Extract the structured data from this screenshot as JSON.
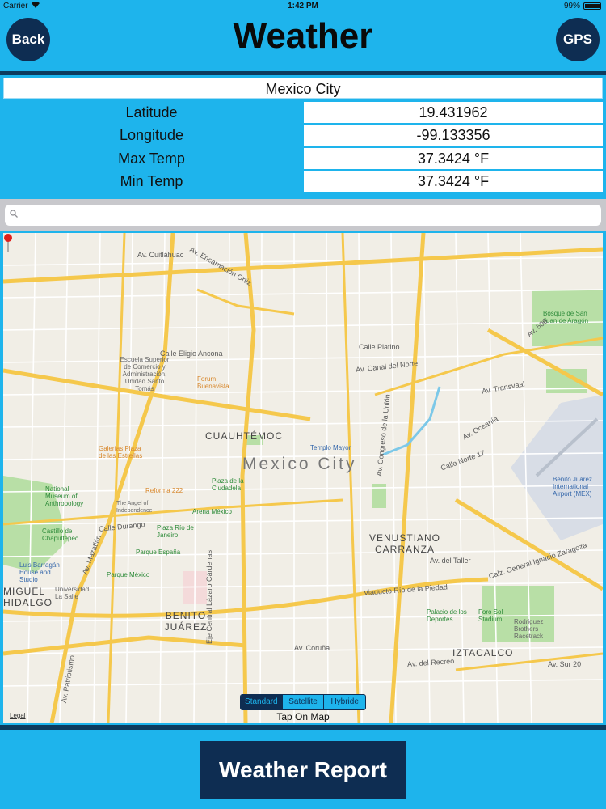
{
  "status_bar": {
    "carrier": "Carrier",
    "time": "1:42 PM",
    "battery": "99%"
  },
  "header": {
    "title": "Weather",
    "back_label": "Back",
    "gps_label": "GPS"
  },
  "location": {
    "city": "Mexico City",
    "rows": [
      {
        "label": "Latitude",
        "value": "19.431962"
      },
      {
        "label": "Longitude",
        "value": "-99.133356"
      },
      {
        "label": "Max Temp",
        "value": "37.3424 °F"
      },
      {
        "label": "Min Temp",
        "value": "37.3424 °F"
      }
    ]
  },
  "search": {
    "placeholder": ""
  },
  "map": {
    "city_label": "Mexico City",
    "pin_label": "Templo Mayor",
    "districts": [
      "CUAUHTÉMOC",
      "VENUSTIANO CARRANZA",
      "BENITO JUÁREZ",
      "IZTACALCO",
      "MIGUEL HIDALGO"
    ],
    "pois": [
      "Bosque de San Juan de Aragón",
      "Escuela Superior de Comercio y Administración, Unidad Santo Tomás",
      "Forum Buenavista",
      "Galerías Plaza de las Estrellas",
      "Reforma 222",
      "National Museum of Anthropology",
      "Castillo de Chapultepec",
      "The Angel of Independence",
      "Plaza de la Ciudadela",
      "Arena México",
      "Plaza Río de Janeiro",
      "Parque España",
      "Parque México",
      "Luis Barragán House and Studio",
      "Universidad La Salle",
      "Palacio de los Deportes",
      "Foro Sol Stadium",
      "Rodriguez Brothers Racetrack",
      "Benito Juárez International Airport (MEX)"
    ],
    "streets": [
      "Av. Cuitláhuac",
      "Av. Encarnación Ortiz",
      "Calle Eligio Ancona",
      "Av. Canal del Norte",
      "Calle Platino",
      "Av. Transvaal",
      "Av. Oceanía",
      "Calz. General Ignacio Zaragoza",
      "Viaducto Río de la Piedad",
      "Av. Coruña",
      "Av. del Recreo",
      "Av. del Taller",
      "Eje Central Lázaro Cárdenas",
      "Av. Patriotismo",
      "Calle Durango",
      "Av. Mazatlán",
      "Av. Congreso de la Unión",
      "Av. 506",
      "Calle Norte 17",
      "Av. Sur 20"
    ],
    "legal": "Legal",
    "map_types": [
      "Standard",
      "Satellite",
      "Hybride"
    ],
    "selected_map_type": "Standard",
    "hint": "Tap On Map"
  },
  "footer": {
    "report_label": "Weather Report"
  },
  "colors": {
    "background": "#1eb4ec",
    "button": "#0e2d52",
    "rule": "#0c3b5e",
    "map_bg": "#f1eee6",
    "road": "#f5c84c",
    "park": "#b8dfa6"
  }
}
